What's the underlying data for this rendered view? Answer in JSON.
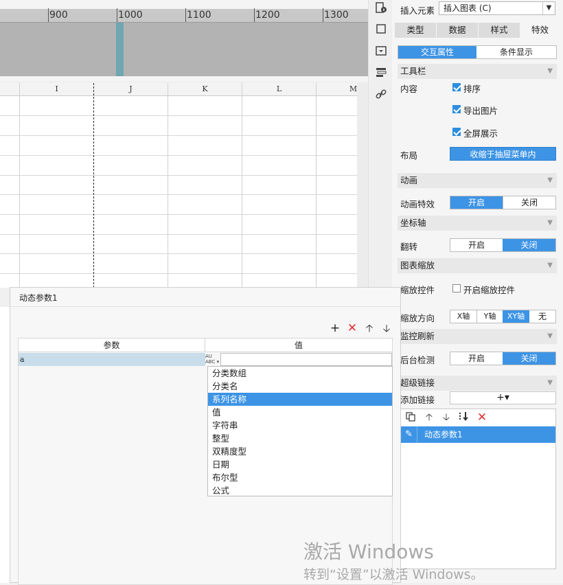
{
  "ruler": {
    "labels": [
      "900",
      "1000",
      "1100",
      "1200",
      "1300"
    ]
  },
  "grid": {
    "columns": [
      "I",
      "J",
      "K",
      "L",
      "M"
    ]
  },
  "panel": {
    "insert_element_label": "插入元素",
    "insert_element_value": "插入图表 (C)",
    "tabs": [
      {
        "label": "类型"
      },
      {
        "label": "数据"
      },
      {
        "label": "样式"
      },
      {
        "label": "特效"
      }
    ],
    "subtabs": {
      "interactive": "交互属性",
      "condition": "条件显示"
    },
    "toolbar_section": "工具栏",
    "content_label": "内容",
    "checks": [
      {
        "label": "排序",
        "checked": true
      },
      {
        "label": "导出图片",
        "checked": true
      },
      {
        "label": "全屏展示",
        "checked": true
      }
    ],
    "layout_label": "布局",
    "layout_value": "收缩于抽屉菜单内",
    "animation_section": "动画",
    "animation_effect_label": "动画特效",
    "axis_section": "坐标轴",
    "flip_label": "翻转",
    "zoom_section": "图表缩放",
    "zoom_control_label": "缩放控件",
    "zoom_control_check": "开启缩放控件",
    "zoom_dir_label": "缩放方向",
    "zoom_dir_options": [
      "X轴",
      "Y轴",
      "XY轴",
      "无"
    ],
    "monitor_section": "监控刷新",
    "background_check_label": "后台检测",
    "on": "开启",
    "off": "关闭",
    "hyperlink_section": "超级链接",
    "add_link_label": "添加链接",
    "add_link_value": "+▾",
    "link_item": "动态参数1"
  },
  "dialog": {
    "title": "动态参数1",
    "col_param": "参数",
    "col_value": "值",
    "row_param": "a",
    "type_icon_text": "AU ABC",
    "type_options": [
      "分类数组",
      "分类名",
      "系列名称",
      "值",
      "字符串",
      "整型",
      "双精度型",
      "日期",
      "布尔型",
      "公式"
    ],
    "selected_option": "系列名称"
  },
  "watermark": {
    "line1": "激活 Windows",
    "line2": "转到“设置”以激活 Windows。"
  }
}
